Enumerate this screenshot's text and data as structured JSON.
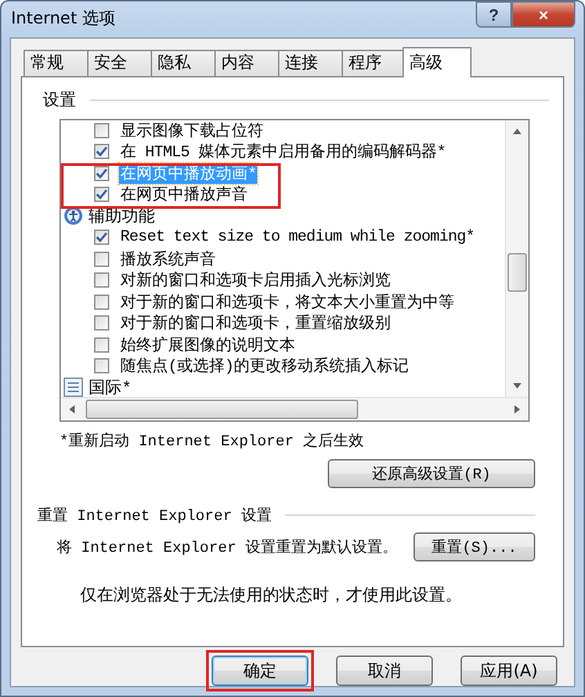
{
  "window": {
    "title": "Internet 选项",
    "help_button": "?",
    "close_button": "×"
  },
  "tabs": [
    {
      "label": "常规",
      "selected": false
    },
    {
      "label": "安全",
      "selected": false
    },
    {
      "label": "隐私",
      "selected": false
    },
    {
      "label": "内容",
      "selected": false
    },
    {
      "label": "连接",
      "selected": false
    },
    {
      "label": "程序",
      "selected": false
    },
    {
      "label": "高级",
      "selected": true
    }
  ],
  "settings": {
    "label": "设置",
    "items": [
      {
        "kind": "checkbox",
        "label": "显示图像下载占位符",
        "checked": false,
        "selected": false,
        "highlighted": false
      },
      {
        "kind": "checkbox",
        "label": "在 HTML5 媒体元素中启用备用的编码解码器*",
        "checked": true,
        "selected": false,
        "highlighted": false
      },
      {
        "kind": "checkbox",
        "label": "在网页中播放动画*",
        "checked": true,
        "selected": true,
        "highlighted": true
      },
      {
        "kind": "checkbox",
        "label": "在网页中播放声音",
        "checked": true,
        "selected": false,
        "highlighted": true
      },
      {
        "kind": "group",
        "label": "辅助功能"
      },
      {
        "kind": "checkbox",
        "label": "Reset text size to medium while zooming*",
        "checked": true,
        "selected": false,
        "highlighted": false
      },
      {
        "kind": "checkbox",
        "label": "播放系统声音",
        "checked": false,
        "selected": false,
        "highlighted": false
      },
      {
        "kind": "checkbox",
        "label": "对新的窗口和选项卡启用插入光标浏览",
        "checked": false,
        "selected": false,
        "highlighted": false
      },
      {
        "kind": "checkbox",
        "label": "对于新的窗口和选项卡，将文本大小重置为中等",
        "checked": false,
        "selected": false,
        "highlighted": false
      },
      {
        "kind": "checkbox",
        "label": "对于新的窗口和选项卡，重置缩放级别",
        "checked": false,
        "selected": false,
        "highlighted": false
      },
      {
        "kind": "checkbox",
        "label": "始终扩展图像的说明文本",
        "checked": false,
        "selected": false,
        "highlighted": false
      },
      {
        "kind": "checkbox",
        "label": "随焦点(或选择)的更改移动系统插入标记",
        "checked": false,
        "selected": false,
        "highlighted": false
      },
      {
        "kind": "group",
        "label": "国际*"
      }
    ],
    "footnote": "*重新启动 Internet Explorer 之后生效",
    "restore_button": "还原高级设置(R)"
  },
  "reset": {
    "heading": "重置 Internet Explorer 设置",
    "description": "将 Internet Explorer 设置重置为默认设置。",
    "button": "重置(S)...",
    "note": "仅在浏览器处于无法使用的状态时，才使用此设置。"
  },
  "buttons": [
    {
      "label": "确定",
      "highlighted": true
    },
    {
      "label": "取消",
      "highlighted": false
    },
    {
      "label": "应用(A)",
      "highlighted": false
    }
  ]
}
